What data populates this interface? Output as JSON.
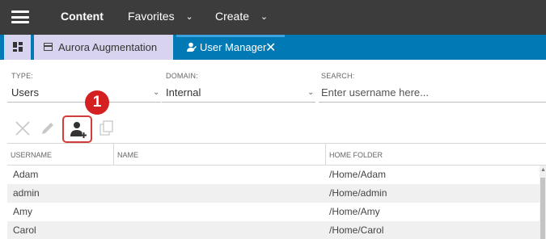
{
  "topbar": {
    "menu_icon": "hamburger-icon",
    "content_label": "Content",
    "favorites_label": "Favorites",
    "create_label": "Create",
    "chevron": "⌄"
  },
  "tabs": {
    "dashboard_icon": "dashboard-icon",
    "items": [
      {
        "label": "Aurora Augmentation",
        "icon": "window-icon"
      },
      {
        "label": "User Manager",
        "icon": "user-manager-icon",
        "close": "✕"
      }
    ]
  },
  "filters": {
    "type": {
      "label": "TYPE:",
      "value": "Users"
    },
    "domain": {
      "label": "DOMAIN:",
      "value": "Internal"
    },
    "search": {
      "label": "SEARCH:",
      "placeholder": "Enter username here..."
    },
    "chevron": "⌄"
  },
  "toolbar": {
    "delete_icon": "close-icon",
    "edit_icon": "pencil-icon",
    "add_user_icon": "add-user-icon",
    "copy_icon": "copy-icon",
    "callout_number": "1",
    "highlight_color": "#d43c3c"
  },
  "table": {
    "headers": [
      "USERNAME",
      "NAME",
      "HOME FOLDER"
    ],
    "rows": [
      {
        "username": "Adam",
        "name": "",
        "home": "/Home/Adam"
      },
      {
        "username": "admin",
        "name": "",
        "home": "/Home/admin"
      },
      {
        "username": "Amy",
        "name": "",
        "home": "/Home/Amy"
      },
      {
        "username": "Carol",
        "name": "",
        "home": "/Home/Carol"
      }
    ]
  },
  "colors": {
    "topbar": "#3c3c3c",
    "tabbar": "#0079b5",
    "inactive_tab": "#d8d4ef",
    "callout": "#d42020"
  }
}
